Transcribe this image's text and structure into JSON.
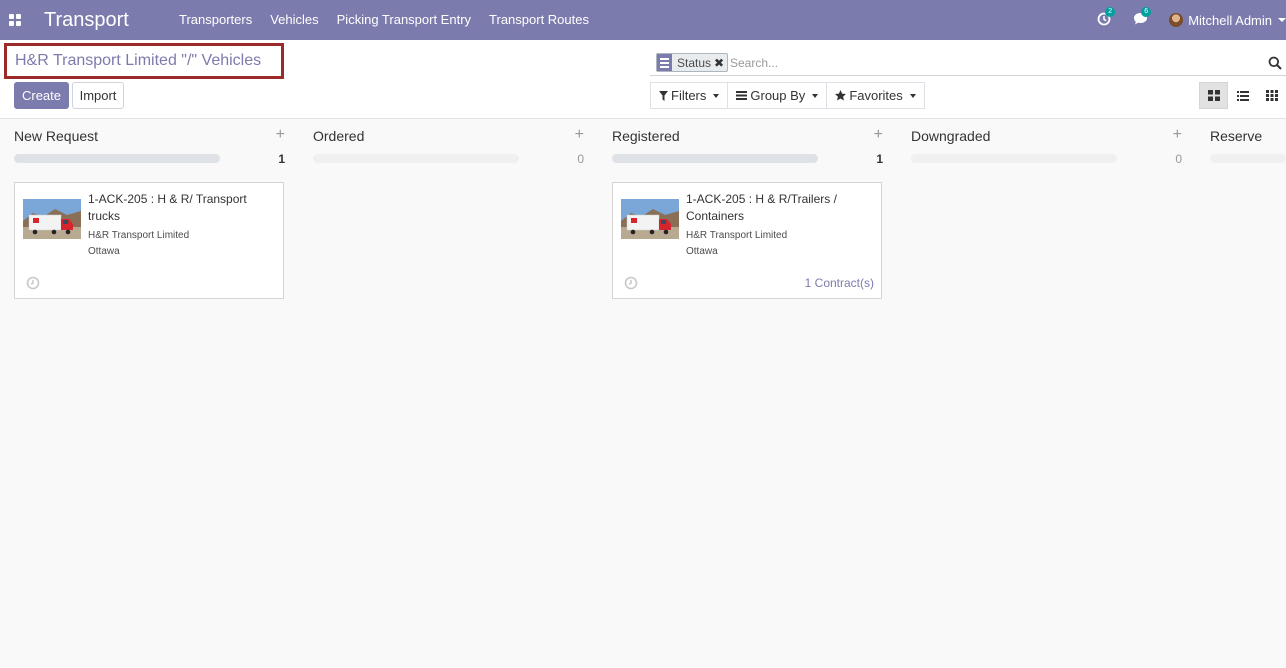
{
  "app": {
    "title": "Transport"
  },
  "menu": [
    "Transporters",
    "Vehicles",
    "Picking Transport Entry",
    "Transport Routes"
  ],
  "systray": {
    "activity_count": "2",
    "messages_count": "6",
    "user_name": "Mitchell Admin"
  },
  "breadcrumb": {
    "title": "H&R Transport Limited \"/\" Vehicles"
  },
  "buttons": {
    "create": "Create",
    "import": "Import"
  },
  "search": {
    "facet_label": "Status",
    "placeholder": "Search..."
  },
  "filters": {
    "filters": "Filters",
    "group_by": "Group By",
    "favorites": "Favorites"
  },
  "columns": [
    {
      "title": "New Request",
      "count": "1",
      "fill": 1.0
    },
    {
      "title": "Ordered",
      "count": "0",
      "fill": 0
    },
    {
      "title": "Registered",
      "count": "1",
      "fill": 1.0
    },
    {
      "title": "Downgraded",
      "count": "0",
      "fill": 0
    },
    {
      "title": "Reserve",
      "count": "",
      "fill": 0
    }
  ],
  "cards": [
    {
      "title": "1-ACK-205 : H & R/ Transport trucks",
      "company": "H&R Transport Limited",
      "city": "Ottawa",
      "contracts": ""
    },
    {
      "title": "1-ACK-205 : H & R/Trailers / Containers",
      "company": "H&R Transport Limited",
      "city": "Ottawa",
      "contracts": "1 Contract(s)"
    }
  ],
  "colors": {
    "brand": "#7c7bad",
    "badge": "#00a09d",
    "highlight_border": "#9b2b2b"
  }
}
